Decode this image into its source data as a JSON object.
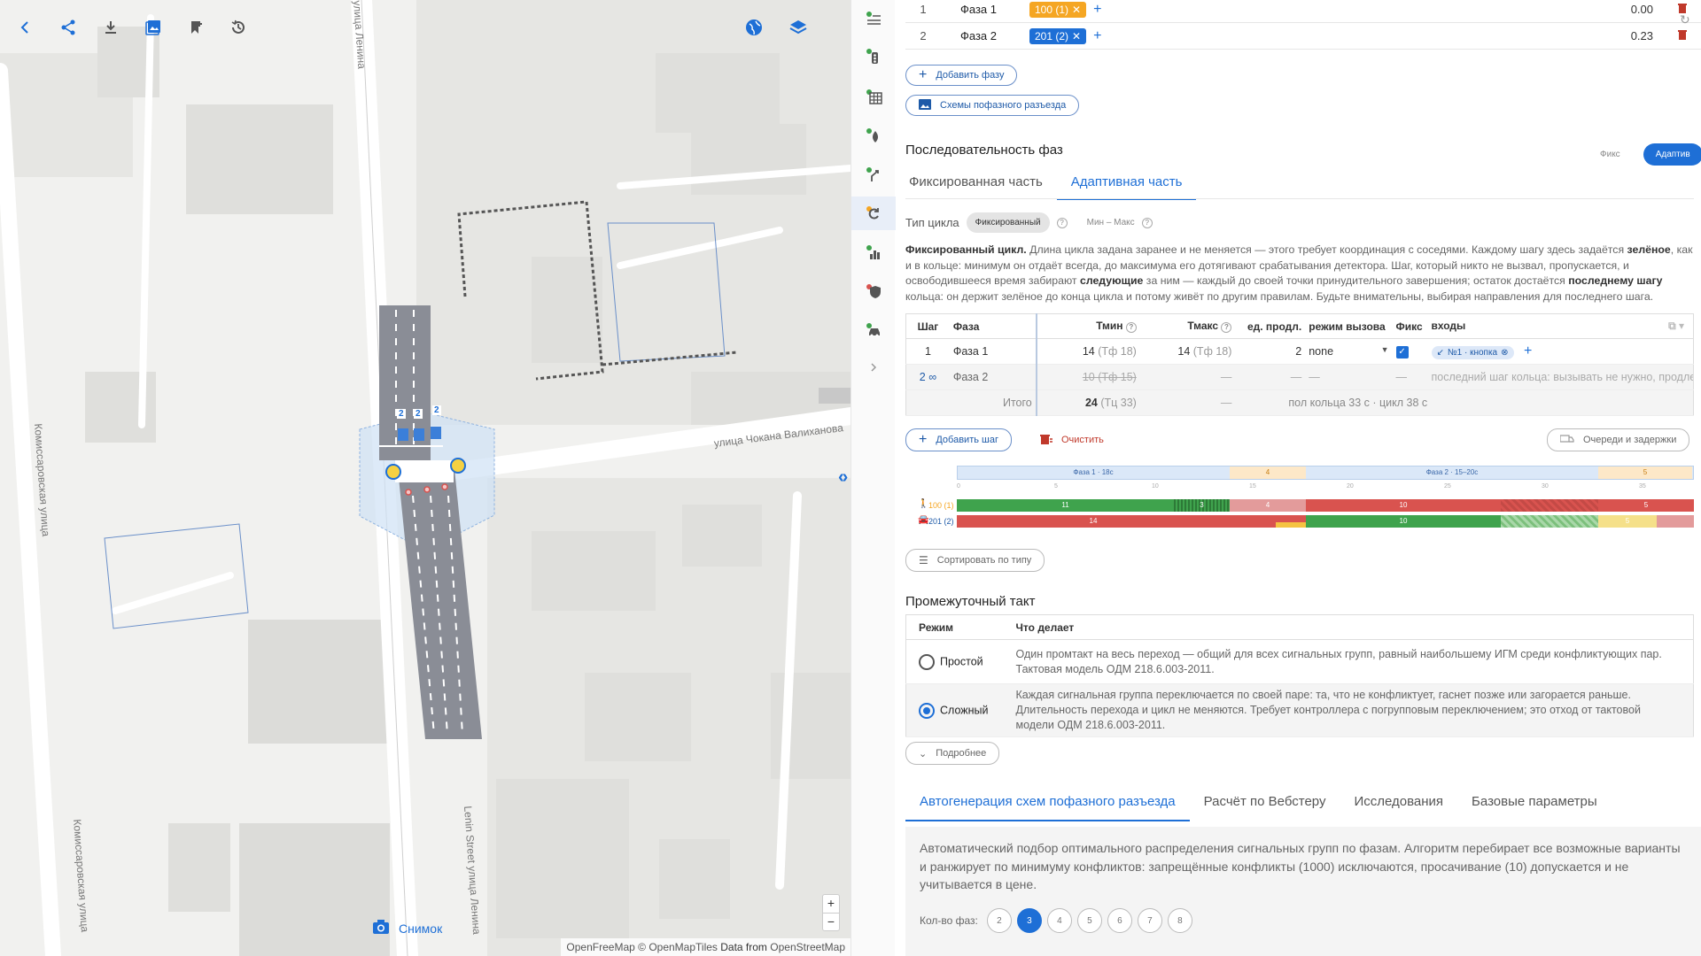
{
  "map": {
    "streets": {
      "lenina_top": "улица Ленина",
      "chokana": "улица Чокана Валиханова",
      "komissar_1": "Комиссаровская улица",
      "komissar_2": "Комиссаровская улица",
      "lenin_bottom": "Lenin Street улица Ленина"
    },
    "lane_marks": [
      "2",
      "2",
      "2"
    ],
    "snapshot_label": "Снимок",
    "zoom_in": "+",
    "zoom_out": "−",
    "attribution": {
      "a": "OpenFreeMap",
      "b": "© OpenMapTiles",
      "c": "Data from",
      "d": "OpenStreetMap"
    }
  },
  "phases": [
    {
      "num": "1",
      "name": "Фаза 1",
      "chip": "100 (1)",
      "value": "0.00"
    },
    {
      "num": "2",
      "name": "Фаза 2",
      "chip": "201 (2)",
      "value": "0.23"
    }
  ],
  "buttons": {
    "add_phase": "Добавить фазу",
    "schemes": "Схемы пофазного разъезда",
    "add_step": "Добавить шаг",
    "clear": "Очистить",
    "queues": "Очереди и задержки",
    "sort": "Сортировать по типу",
    "more": "Подробнее"
  },
  "sequence": {
    "title": "Последовательность фаз",
    "mode_fix": "Фикс",
    "mode_adaptive": "Адаптив",
    "tab_fixed": "Фиксированная часть",
    "tab_adaptive": "Адаптивная часть",
    "cycle_type_label": "Тип цикла",
    "cycle_fixed": "Фиксированный",
    "cycle_minmax": "Мин – Макс",
    "desc": {
      "p1": "Фиксированный цикл.",
      "p2": " Длина цикла задана заранее и не меняется — этого требует координация с соседями. Каждому шагу здесь задаётся ",
      "p3": "зелёное",
      "p4": ", как и в кольце: минимум он отдаёт всегда, до максимума его дотягивают срабатывания детектора. Шаг, который никто не вызвал, пропускается, и освободившееся время забирают ",
      "p5": "следующие",
      "p6": " за ним — каждый до своей точки принудительного завершения; остаток достаётся ",
      "p7": "последнему шагу",
      "p8": " кольца: он держит зелёное до конца цикла и потому живёт по другим правилам. Будьте внимательны, выбирая направления для последнего шага."
    }
  },
  "steps_table": {
    "headers": {
      "step": "Шаг",
      "phase": "Фаза",
      "tmin": "Тмин",
      "tmax": "Тмакс",
      "ext": "ед. продл.",
      "call": "режим вызова",
      "fix": "Фикс",
      "inputs": "входы"
    },
    "row1": {
      "step": "1",
      "phase": "Фаза 1",
      "tmin": "14",
      "tmin_sub": "(Тф 18)",
      "tmax": "14",
      "tmax_sub": "(Тф 18)",
      "ext": "2",
      "call": "none",
      "input": "№1 · кнопка"
    },
    "row2": {
      "step": "2",
      "phase": "Фаза 2",
      "tmin": "10 (Тф 15)",
      "tmax": "—",
      "ext": "—",
      "call": "—",
      "fix": "—",
      "note": "последний шаг кольца: вызывать не нужно, продлевать"
    },
    "total": {
      "label": "Итого",
      "tmin": "24",
      "tmin_sub": "(Тц 33)",
      "tmax": "—",
      "note": "пол кольца 33 с · цикл 38 с"
    }
  },
  "timeline": {
    "phase1": "Фаза 1 · 18с",
    "inter1": "4",
    "phase2": "Фаза 2 · 15–20с",
    "inter2": "5",
    "ticks": [
      "0",
      "5",
      "10",
      "15",
      "20",
      "25",
      "30",
      "35"
    ],
    "rows": [
      {
        "label": "100 (1)",
        "g1": "11",
        "g2": "3",
        "r1": "4",
        "r2": "10",
        "r3": "5"
      },
      {
        "label": "201 (2)",
        "r1": "14",
        "g1": "10",
        "y1": "5"
      }
    ]
  },
  "intermediate": {
    "title": "Промежуточный такт",
    "headers": {
      "mode": "Режим",
      "what": "Что делает"
    },
    "simple": {
      "label": "Простой",
      "text": "Один промтакт на весь переход — общий для всех сигнальных групп, равный наибольшему ИГМ среди конфликтующих пар. Тактовая модель ОДМ 218.6.003-2011."
    },
    "complex": {
      "label": "Сложный",
      "text": "Каждая сигнальная группа переключается по своей паре: та, что не конфликтует, гаснет позже или загорается раньше. Длительность перехода и цикл не меняются. Требует контроллера с погрупповым переключением; это отход от тактовой модели ОДМ 218.6.003-2011."
    }
  },
  "bottom_tabs": [
    "Автогенерация схем пофазного разъезда",
    "Расчёт по Вебстеру",
    "Исследования",
    "Базовые параметры"
  ],
  "autogen": {
    "text": "Автоматический подбор оптимального распределения сигнальных групп по фазам. Алгоритм перебирает все возможные варианты и ранжирует по минимуму конфликтов: запрещённые конфликты (1000) исключаются, просачивание (10) допускается и не учитывается в цене.",
    "count_label": "Кол-во фаз:",
    "counts": [
      "2",
      "3",
      "4",
      "5",
      "6",
      "7",
      "8"
    ]
  },
  "colors": {
    "accent": "#1e6fd6",
    "green": "#3fa34d",
    "red": "#d9534f",
    "yellow": "#f5c342",
    "orange": "#f5a623"
  }
}
